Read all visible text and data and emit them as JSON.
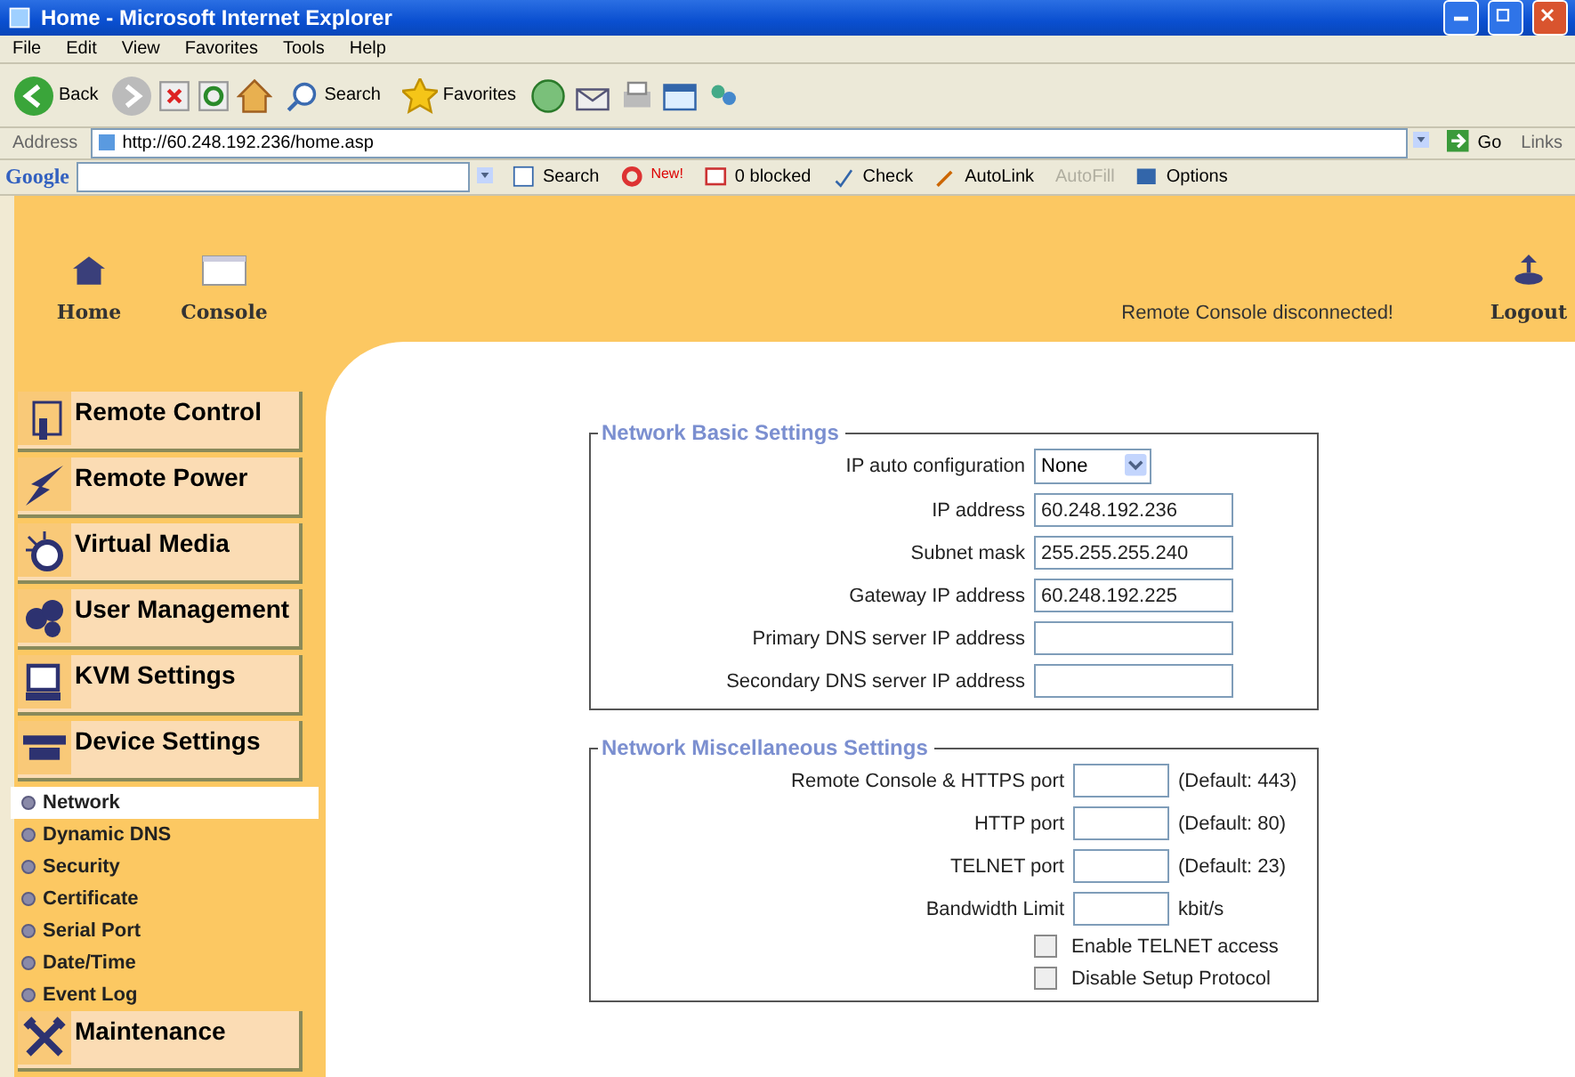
{
  "window": {
    "title": "Home - Microsoft Internet Explorer"
  },
  "menu_bar": [
    "File",
    "Edit",
    "View",
    "Favorites",
    "Tools",
    "Help"
  ],
  "toolbar": {
    "back": "Back",
    "search": "Search",
    "favorites": "Favorites"
  },
  "address_bar": {
    "label": "Address",
    "url": "http://60.248.192.236/home.asp",
    "go": "Go",
    "links": "Links"
  },
  "google_bar": {
    "logo": "Google",
    "search": "Search",
    "new_badge": "New!",
    "blocked": "0 blocked",
    "check": "Check",
    "autolink": "AutoLink",
    "autofill": {
      "label": "AutoFill",
      "disabled": true
    },
    "options": "Options"
  },
  "header": {
    "nav": [
      {
        "label": "Home"
      },
      {
        "label": "Console"
      }
    ],
    "status": "Remote Console disconnected!",
    "logout": "Logout"
  },
  "sidebar": {
    "items": [
      {
        "label": "Remote Control"
      },
      {
        "label": "Remote Power"
      },
      {
        "label": "Virtual Media"
      },
      {
        "label": "User Management"
      },
      {
        "label": "KVM Settings"
      },
      {
        "label": "Device Settings",
        "children": [
          {
            "label": "Network",
            "selected": true
          },
          {
            "label": "Dynamic DNS",
            "selected": false
          },
          {
            "label": "Security",
            "selected": false
          },
          {
            "label": "Certificate",
            "selected": false
          },
          {
            "label": "Serial Port",
            "selected": false
          },
          {
            "label": "Date/Time",
            "selected": false
          },
          {
            "label": "Event Log",
            "selected": false
          }
        ]
      },
      {
        "label": "Maintenance"
      }
    ]
  },
  "fieldsets": [
    {
      "legend": "Network Basic Settings",
      "rows": [
        {
          "kind": "select",
          "label": "IP auto configuration",
          "value": "None"
        },
        {
          "kind": "text",
          "label": "IP address",
          "value": "60.248.192.236"
        },
        {
          "kind": "text",
          "label": "Subnet mask",
          "value": "255.255.255.240"
        },
        {
          "kind": "text",
          "label": "Gateway IP address",
          "value": "60.248.192.225"
        },
        {
          "kind": "text",
          "label": "Primary DNS server IP address"
        },
        {
          "kind": "text",
          "label": "Secondary DNS server IP address"
        }
      ]
    },
    {
      "legend": "Network Miscellaneous Settings",
      "rows": [
        {
          "kind": "short",
          "label": "Remote Console & HTTPS port",
          "note": "(Default: 443)"
        },
        {
          "kind": "short",
          "label": "HTTP port",
          "note": "(Default: 80)"
        },
        {
          "kind": "short",
          "label": "TELNET port",
          "note": "(Default: 23)"
        },
        {
          "kind": "short",
          "label": "Bandwidth Limit",
          "note": "kbit/s"
        },
        {
          "kind": "checkbox",
          "label": "Enable TELNET access",
          "checked": false
        },
        {
          "kind": "checkbox",
          "label": "Disable Setup Protocol",
          "checked": false
        }
      ]
    }
  ]
}
